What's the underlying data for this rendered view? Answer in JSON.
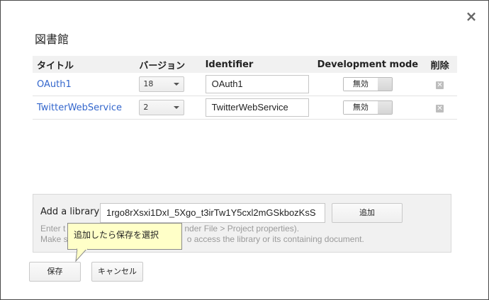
{
  "dialog": {
    "title": "図書館",
    "close_glyph": "×"
  },
  "table": {
    "headers": {
      "title": "タイトル",
      "version": "バージョン",
      "identifier": "Identifier",
      "dev_mode": "Development mode",
      "delete": "削除"
    },
    "rows": [
      {
        "title": "OAuth1",
        "version": "18",
        "identifier": "OAuth1",
        "dev_mode": "無効"
      },
      {
        "title": "TwitterWebService",
        "version": "2",
        "identifier": "TwitterWebService",
        "dev_mode": "無効"
      }
    ]
  },
  "add_library": {
    "label": "Add a library",
    "value": "1rgo8rXsxi1DxI_5Xgo_t3irTw1Y5cxl2mGSkbozKsS",
    "button": "追加",
    "help_line1_start": "Enter t",
    "help_line1_end": "nder File > Project properties).",
    "help_line2_start": "Make s",
    "help_line2_end": "o access the library or its containing document."
  },
  "footer": {
    "save": "保存",
    "cancel": "キャンセル"
  },
  "callout": {
    "text": "追加したら保存を選択"
  },
  "colors": {
    "link": "#3366cc",
    "callout_bg": "#ffffc8"
  }
}
